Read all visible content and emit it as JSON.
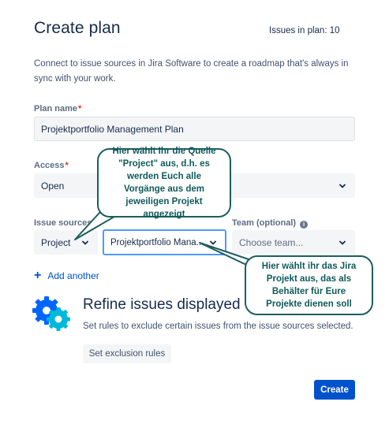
{
  "header": {
    "title": "Create plan",
    "issues_count": "Issues in plan: 10"
  },
  "description": "Connect to issue sources in Jira Software to create a roadmap that's always in sync with your work.",
  "plan_name": {
    "label": "Plan name",
    "required_mark": "*",
    "value": "Projektportfolio Management Plan"
  },
  "access": {
    "label": "Access",
    "required_mark": "*",
    "value": "Open"
  },
  "issue_sources": {
    "label": "Issue sources",
    "required_mark": "*",
    "type_value": "Project",
    "project_value": "Projektportfolio Mana..."
  },
  "team": {
    "label": "Team (optional)",
    "placeholder": "Choose team..."
  },
  "add_another": {
    "label": "Add another"
  },
  "refine": {
    "title": "Refine issues displayed",
    "description": "Set rules to exclude certain issues from the issue sources selected.",
    "button_label": "Set exclusion rules"
  },
  "create_button": "Create",
  "annotations": {
    "source_callout": "Hier wählt Ihr die Quelle \"Project\" aus, d.h. es werden Euch alle Vorgänge aus dem jeweiligen Projekt angezeigt",
    "project_callout": "Hier wählt ihr das Jira Projekt aus, das als Behälter für Eure Projekte dienen soll"
  },
  "icons": {
    "chevron": "chevron-down-icon",
    "info": "info-icon",
    "plus": "plus-icon",
    "refine": "gears-icon"
  },
  "colors": {
    "primary": "#0052cc",
    "required": "#de350b",
    "focus_border": "#4c9aff",
    "callout_border": "#1d5e5e",
    "gear_blue": "#0065ff",
    "gear_teal": "#00b8d9"
  }
}
